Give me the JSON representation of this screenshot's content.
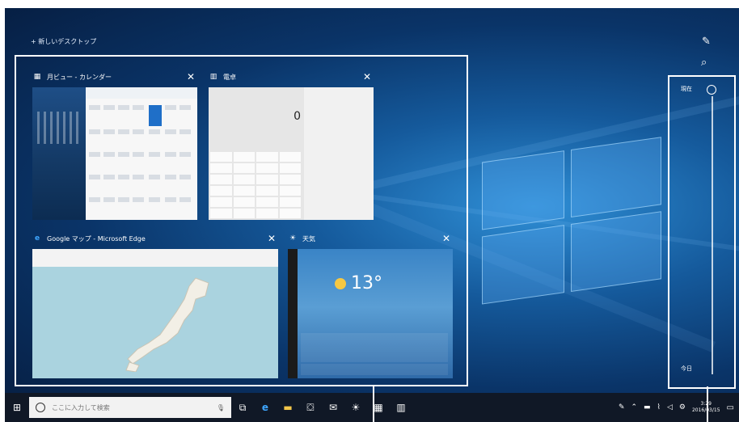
{
  "desktop": {
    "new_desktop_label": "+ 新しいデスクトップ"
  },
  "windows": [
    {
      "title": "月ビュー - カレンダー",
      "icon": "calendar-icon",
      "close": "✕"
    },
    {
      "title": "電卓",
      "icon": "calculator-icon",
      "close": "✕",
      "display_value": "0"
    },
    {
      "title": "Google マップ - Microsoft Edge",
      "icon": "edge-icon",
      "close": "✕"
    },
    {
      "title": "天気",
      "icon": "weather-sun-icon",
      "close": "✕",
      "temperature": "13°"
    }
  ],
  "timeline": {
    "top_label": "現在",
    "bottom_label": "今日"
  },
  "taskbar": {
    "search_placeholder": "ここに入力して検索",
    "clock_time": "3:29",
    "clock_date": "2016/03/15"
  },
  "colors": {
    "taskbar": "#101826",
    "accent": "#1f6fc8",
    "frame": "#ffffff"
  }
}
